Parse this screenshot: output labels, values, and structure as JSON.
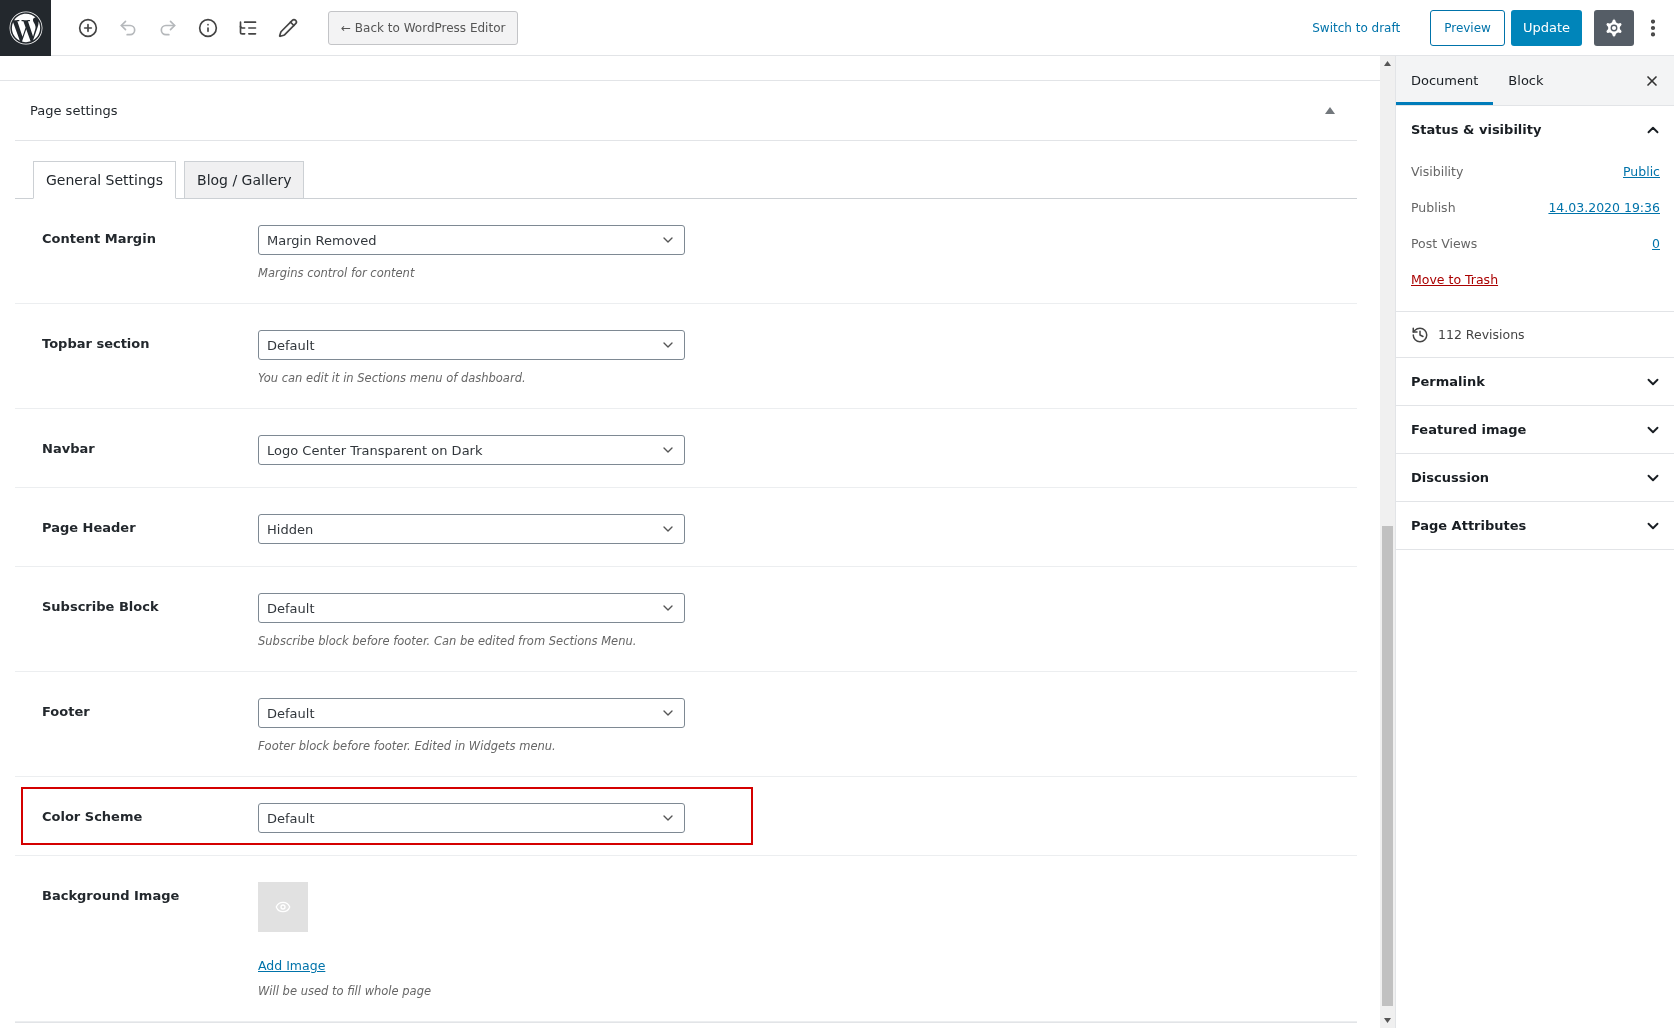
{
  "topbar": {
    "tools": [
      {
        "kind": "add",
        "disabled": false
      },
      {
        "kind": "undo",
        "disabled": true
      },
      {
        "kind": "redo",
        "disabled": true
      },
      {
        "kind": "info",
        "disabled": false
      },
      {
        "kind": "outline",
        "disabled": false
      },
      {
        "kind": "edit",
        "disabled": false
      }
    ],
    "back_button": "← Back to WordPress Editor",
    "switch_to_draft": "Switch to draft",
    "preview": "Preview",
    "update": "Update",
    "settings_active": true
  },
  "panel": {
    "title": "Page settings",
    "expanded": true,
    "tabs": [
      {
        "label": "General Settings",
        "selected": true
      },
      {
        "label": "Blog / Gallery",
        "selected": false
      }
    ],
    "rows": [
      {
        "kind": "select",
        "label": "Content Margin",
        "value": "Margin Removed",
        "hint": "Margins control for content",
        "highlighted": false
      },
      {
        "kind": "select",
        "label": "Topbar section",
        "value": "Default",
        "hint": "You can edit it in Sections menu of dashboard.",
        "highlighted": false
      },
      {
        "kind": "select",
        "label": "Navbar",
        "value": "Logo Center Transparent on Dark",
        "highlighted": false
      },
      {
        "kind": "select",
        "label": "Page Header",
        "value": "Hidden",
        "highlighted": false
      },
      {
        "kind": "select",
        "label": "Subscribe Block",
        "value": "Default",
        "hint": "Subscribe block before footer. Can be edited from Sections Menu.",
        "highlighted": false
      },
      {
        "kind": "select",
        "label": "Footer",
        "value": "Default",
        "hint": "Footer block before footer. Edited in Widgets menu.",
        "highlighted": false
      },
      {
        "kind": "select",
        "label": "Color Scheme",
        "value": "Default",
        "highlighted": true
      },
      {
        "kind": "image",
        "label": "Background Image",
        "link": "Add Image",
        "hint": "Will be used to fill whole page",
        "highlighted": false
      }
    ]
  },
  "sidebar": {
    "tabs": [
      {
        "label": "Document",
        "selected": true
      },
      {
        "label": "Block",
        "selected": false
      }
    ],
    "status": {
      "title": "Status & visibility",
      "expanded": true,
      "fields": [
        {
          "label": "Visibility",
          "value": "Public"
        },
        {
          "label": "Publish",
          "value": "14.03.2020 19:36"
        },
        {
          "label": "Post Views",
          "value": "0"
        }
      ],
      "trash": "Move to Trash"
    },
    "revisions": "112 Revisions",
    "sections": [
      {
        "title": "Permalink",
        "expanded": false
      },
      {
        "title": "Featured image",
        "expanded": false
      },
      {
        "title": "Discussion",
        "expanded": false
      },
      {
        "title": "Page Attributes",
        "expanded": false
      }
    ]
  }
}
